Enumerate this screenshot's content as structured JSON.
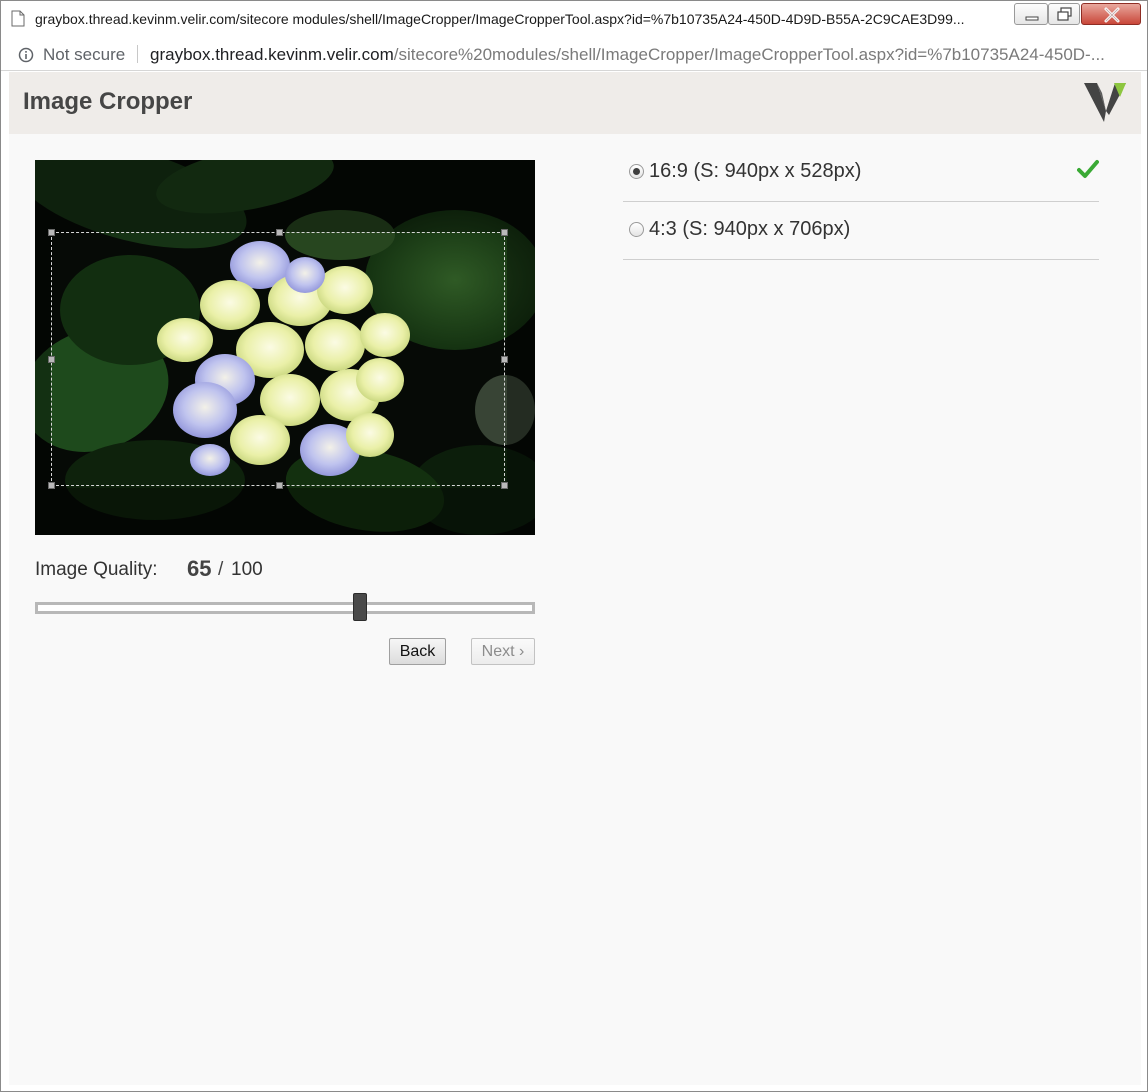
{
  "window": {
    "title": "graybox.thread.kevinm.velir.com/sitecore modules/shell/ImageCropper/ImageCropperTool.aspx?id=%7b10735A24-450D-4D9D-B55A-2C9CAE3D99..."
  },
  "address_bar": {
    "security_label": "Not secure",
    "url_host": "graybox.thread.kevinm.velir.com",
    "url_path": "/sitecore%20modules/shell/ImageCropper/ImageCropperTool.aspx?id=%7b10735A24-450D-..."
  },
  "app": {
    "title": "Image Cropper",
    "logo_icon": "velir-v-logo-icon",
    "accent_color": "#8dc63f"
  },
  "preview": {
    "image_subject": "hydrangea-photo"
  },
  "quality": {
    "label": "Image Quality:",
    "value": "65",
    "separator": "/",
    "max": "100",
    "slider_fraction": 0.65
  },
  "buttons": {
    "back": "Back",
    "next": "Next ›"
  },
  "ratios": [
    {
      "label": "16:9 (S: 940px x 528px)",
      "selected": true,
      "done": true
    },
    {
      "label": "4:3 (S: 940px x 706px)",
      "selected": false,
      "done": false
    }
  ],
  "colors": {
    "checkmark": "#3aaa35",
    "header_bg": "#efece9"
  }
}
